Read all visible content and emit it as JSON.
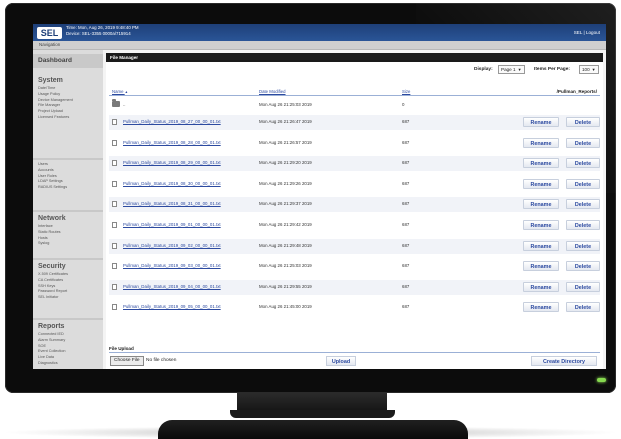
{
  "topbar": {
    "logo": "SEL",
    "line1": "Time: Mon, Aug 26, 2019 9:48:40 PM",
    "line2": "Device: SEL-3355 0000a/715914",
    "user": "SEL | Logout"
  },
  "nav": {
    "label": "Navigation"
  },
  "sidebar": {
    "dashboard": "Dashboard",
    "sections": [
      {
        "title": "System",
        "items": [
          "Date/Time",
          "Usage Policy",
          "Device Management",
          "File Manager",
          "Project Upload",
          "Licensed Features"
        ]
      },
      {
        "title": "",
        "items": [
          "Users",
          "Accounts",
          "User Roles",
          "LDAP Settings",
          "RADIUS Settings"
        ]
      },
      {
        "title": "Network",
        "items": [
          "Interface",
          "Static Routes",
          "Hosts",
          "Syslog"
        ]
      },
      {
        "title": "Security",
        "items": [
          "X.509 Certificates",
          "CA Certificates",
          "SSH Keys",
          "Password Report",
          "SEL Initiator"
        ]
      },
      {
        "title": "Reports",
        "items": [
          "Connected IED",
          "Alarm Summary",
          "SOE",
          "Event Collection",
          "Live Data",
          "Diagnostics"
        ]
      }
    ]
  },
  "file_manager": {
    "header": "File Manager",
    "display_label": "Display:",
    "display_value": "Page 1",
    "items_label": "Items Per Page:",
    "items_value": "100",
    "columns": {
      "name": "Name",
      "sort_indicator": "▲",
      "date": "Date Modified",
      "size": "Size"
    },
    "path": "/Pullman_Reports/",
    "parent_row": {
      "name": "..",
      "date": "Mon Aug 26 21:25:03 2019",
      "size": "0"
    },
    "rename_label": "Rename",
    "delete_label": "Delete",
    "files": [
      {
        "name": "Pullman_Daily_Status_2019_08_27_00_00_01.txt",
        "date": "Mon Aug 26 21:26:47 2019",
        "size": "687"
      },
      {
        "name": "Pullman_Daily_Status_2019_08_28_00_00_01.txt",
        "date": "Mon Aug 26 21:26:57 2019",
        "size": "687"
      },
      {
        "name": "Pullman_Daily_Status_2019_08_29_00_00_01.txt",
        "date": "Mon Aug 26 21:29:20 2019",
        "size": "687"
      },
      {
        "name": "Pullman_Daily_Status_2019_08_30_00_00_01.txt",
        "date": "Mon Aug 26 21:29:26 2019",
        "size": "687"
      },
      {
        "name": "Pullman_Daily_Status_2019_08_31_00_00_01.txt",
        "date": "Mon Aug 26 21:29:37 2019",
        "size": "687"
      },
      {
        "name": "Pullman_Daily_Status_2019_09_01_00_00_01.txt",
        "date": "Mon Aug 26 21:29:42 2019",
        "size": "687"
      },
      {
        "name": "Pullman_Daily_Status_2019_09_02_00_00_01.txt",
        "date": "Mon Aug 26 21:29:48 2019",
        "size": "687"
      },
      {
        "name": "Pullman_Daily_Status_2019_09_03_00_00_01.txt",
        "date": "Mon Aug 26 21:25:03 2019",
        "size": "687"
      },
      {
        "name": "Pullman_Daily_Status_2019_09_04_00_00_01.txt",
        "date": "Mon Aug 26 21:29:55 2019",
        "size": "687"
      },
      {
        "name": "Pullman_Daily_Status_2019_09_05_00_00_01.txt",
        "date": "Mon Aug 26 21:45:00 2019",
        "size": "687"
      }
    ],
    "upload": {
      "label": "File Upload",
      "choose_label": "Choose File",
      "no_file": "No file chosen",
      "upload_label": "Upload",
      "create_dir_label": "Create Directory"
    }
  }
}
